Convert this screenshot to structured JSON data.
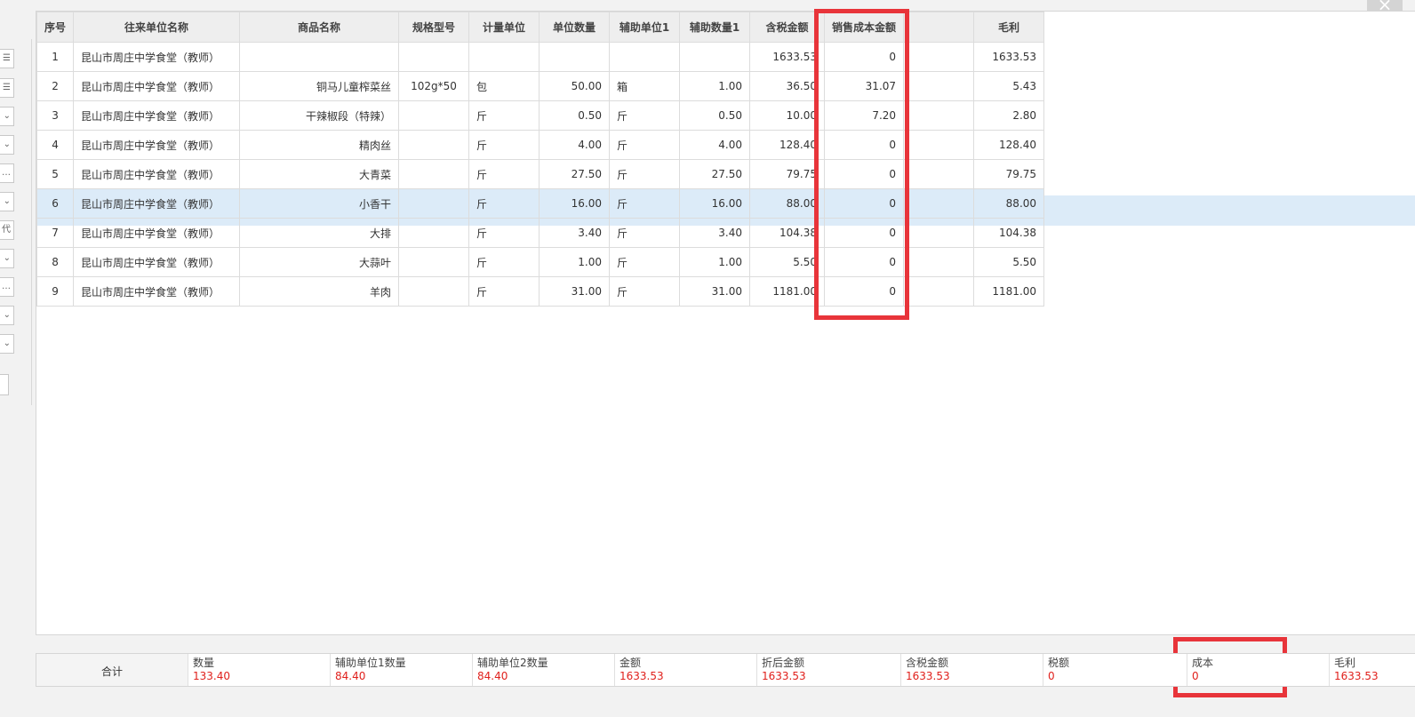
{
  "window": {
    "close_glyph": "×"
  },
  "left_panel": {
    "controls": [
      "☰",
      "☰",
      "⌄",
      "⌄",
      "…",
      "⌄",
      "代",
      "⌄",
      "…",
      "⌄",
      "⌄"
    ]
  },
  "grid": {
    "headers": [
      "序号",
      "往来单位名称",
      "商品名称",
      "规格型号",
      "计量单位",
      "单位数量",
      "辅助单位1",
      "辅助数量1",
      "含税金额",
      "销售成本金额",
      "",
      "毛利"
    ],
    "rows": [
      {
        "seq": "1",
        "customer": "昆山市周庄中学食堂（教师）",
        "product": "",
        "spec": "",
        "unit": "",
        "qty": "",
        "aux_unit": "",
        "aux_qty": "",
        "amount": "1633.53",
        "cost": "0",
        "blank": "",
        "gross": "1633.53"
      },
      {
        "seq": "2",
        "customer": "昆山市周庄中学食堂（教师）",
        "product": "铜马儿童榨菜丝",
        "spec": "102g*50",
        "unit": "包",
        "qty": "50.00",
        "aux_unit": "箱",
        "aux_qty": "1.00",
        "amount": "36.50",
        "cost": "31.07",
        "blank": "",
        "gross": "5.43"
      },
      {
        "seq": "3",
        "customer": "昆山市周庄中学食堂（教师）",
        "product": "干辣椒段（特辣）",
        "spec": "",
        "unit": "斤",
        "qty": "0.50",
        "aux_unit": "斤",
        "aux_qty": "0.50",
        "amount": "10.00",
        "cost": "7.20",
        "blank": "",
        "gross": "2.80"
      },
      {
        "seq": "4",
        "customer": "昆山市周庄中学食堂（教师）",
        "product": "精肉丝",
        "spec": "",
        "unit": "斤",
        "qty": "4.00",
        "aux_unit": "斤",
        "aux_qty": "4.00",
        "amount": "128.40",
        "cost": "0",
        "blank": "",
        "gross": "128.40"
      },
      {
        "seq": "5",
        "customer": "昆山市周庄中学食堂（教师）",
        "product": "大青菜",
        "spec": "",
        "unit": "斤",
        "qty": "27.50",
        "aux_unit": "斤",
        "aux_qty": "27.50",
        "amount": "79.75",
        "cost": "0",
        "blank": "",
        "gross": "79.75"
      },
      {
        "seq": "6",
        "customer": "昆山市周庄中学食堂（教师）",
        "product": "小香干",
        "spec": "",
        "unit": "斤",
        "qty": "16.00",
        "aux_unit": "斤",
        "aux_qty": "16.00",
        "amount": "88.00",
        "cost": "0",
        "blank": "",
        "gross": "88.00"
      },
      {
        "seq": "7",
        "customer": "昆山市周庄中学食堂（教师）",
        "product": "大排",
        "spec": "",
        "unit": "斤",
        "qty": "3.40",
        "aux_unit": "斤",
        "aux_qty": "3.40",
        "amount": "104.38",
        "cost": "0",
        "blank": "",
        "gross": "104.38"
      },
      {
        "seq": "8",
        "customer": "昆山市周庄中学食堂（教师）",
        "product": "大蒜叶",
        "spec": "",
        "unit": "斤",
        "qty": "1.00",
        "aux_unit": "斤",
        "aux_qty": "1.00",
        "amount": "5.50",
        "cost": "0",
        "blank": "",
        "gross": "5.50"
      },
      {
        "seq": "9",
        "customer": "昆山市周庄中学食堂（教师）",
        "product": "羊肉",
        "spec": "",
        "unit": "斤",
        "qty": "31.00",
        "aux_unit": "斤",
        "aux_qty": "31.00",
        "amount": "1181.00",
        "cost": "0",
        "blank": "",
        "gross": "1181.00"
      }
    ],
    "selected_row": 6
  },
  "summary": {
    "label": "合计",
    "items": [
      {
        "label": "数量",
        "value": "133.40"
      },
      {
        "label": "辅助单位1数量",
        "value": "84.40"
      },
      {
        "label": "辅助单位2数量",
        "value": "84.40"
      },
      {
        "label": "金额",
        "value": "1633.53"
      },
      {
        "label": "折后金额",
        "value": "1633.53"
      },
      {
        "label": "含税金额",
        "value": "1633.53"
      },
      {
        "label": "税额",
        "value": "0"
      },
      {
        "label": "成本",
        "value": "0"
      },
      {
        "label": "毛利",
        "value": "1633.53"
      }
    ]
  },
  "colors": {
    "annotation_red": "#e8343a",
    "summary_value_red": "#e0201c",
    "selected_row": "#dcebf8"
  }
}
